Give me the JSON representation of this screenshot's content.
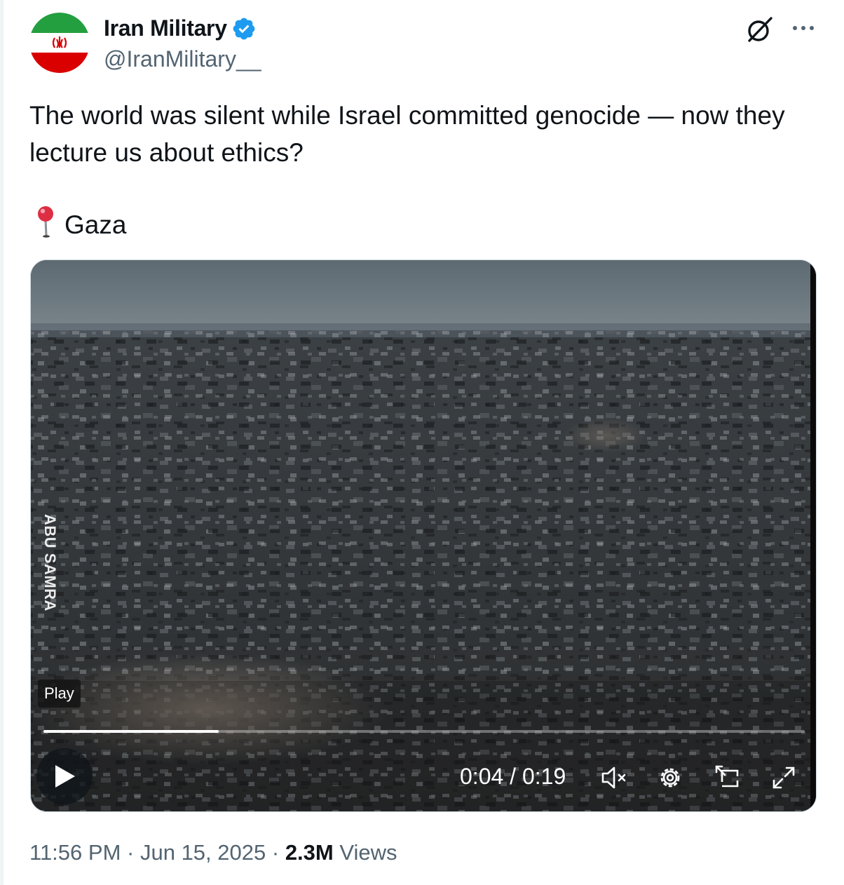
{
  "author": {
    "display_name": "Iran Military",
    "handle": "@IranMilitary__",
    "verified": true,
    "avatar_icon": "iran-flag-icon",
    "colors": {
      "verified": "#1d9bf0",
      "flag_green": "#239f40",
      "flag_red": "#da0000"
    }
  },
  "tweet": {
    "text": "The world was silent while Israel committed genocide — now they lecture us about ethics?",
    "location_icon": "round-pushpin-icon",
    "location_label": "Gaza"
  },
  "video": {
    "watermark": "ABU SAMRA",
    "tooltip": "Play",
    "progress_fraction": 0.23,
    "time": "0:04 / 0:19",
    "controls": [
      "play-icon",
      "muted-speaker-icon",
      "settings-gear-icon",
      "pip-icon",
      "fullscreen-icon"
    ]
  },
  "footer": {
    "time": "11:56 PM",
    "separator": "·",
    "date": "Jun 15, 2025",
    "views_count": "2.3M",
    "views_label": "Views"
  }
}
